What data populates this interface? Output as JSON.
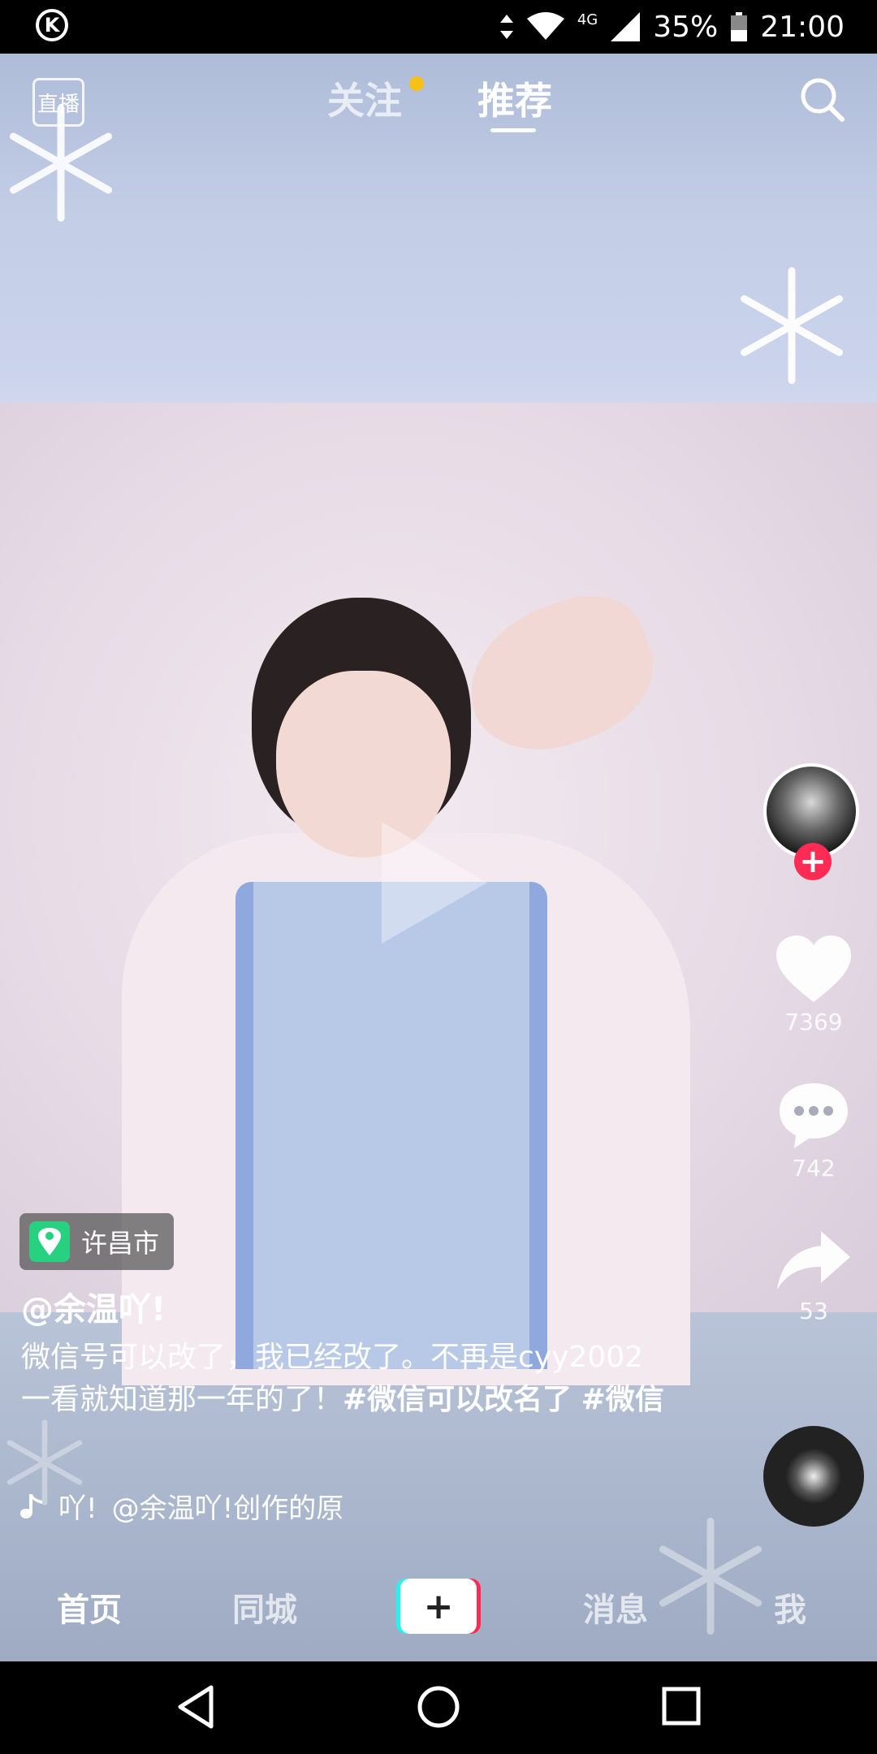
{
  "status_bar": {
    "app_badge": "K",
    "data_type": "4G",
    "battery": "35%",
    "time": "21:00"
  },
  "top_nav": {
    "live_label": "直播",
    "tab_follow": "关注",
    "tab_recommend": "推荐",
    "active_tab": "推荐"
  },
  "sidebar": {
    "likes": "7369",
    "comments": "742",
    "shares": "53"
  },
  "video": {
    "location": "许昌市",
    "author": "@余温吖!",
    "caption_text": "微信号可以改了，我已经改了。不再是cyy2002一看就知道那一年的了！",
    "hashtag_1": "#微信可以改名了",
    "hashtag_2": "#微信",
    "music_prefix": "吖!",
    "music_text": "@余温吖!创作的原",
    "music_icon": "music-note-icon"
  },
  "bottom_nav": {
    "home": "首页",
    "city": "同城",
    "create": "+",
    "messages": "消息",
    "me": "我"
  },
  "colors": {
    "accent_red": "#fe2c55",
    "accent_cyan": "#25f4ee",
    "follow_dot": "#f6c117",
    "location_green": "#27d17f"
  }
}
